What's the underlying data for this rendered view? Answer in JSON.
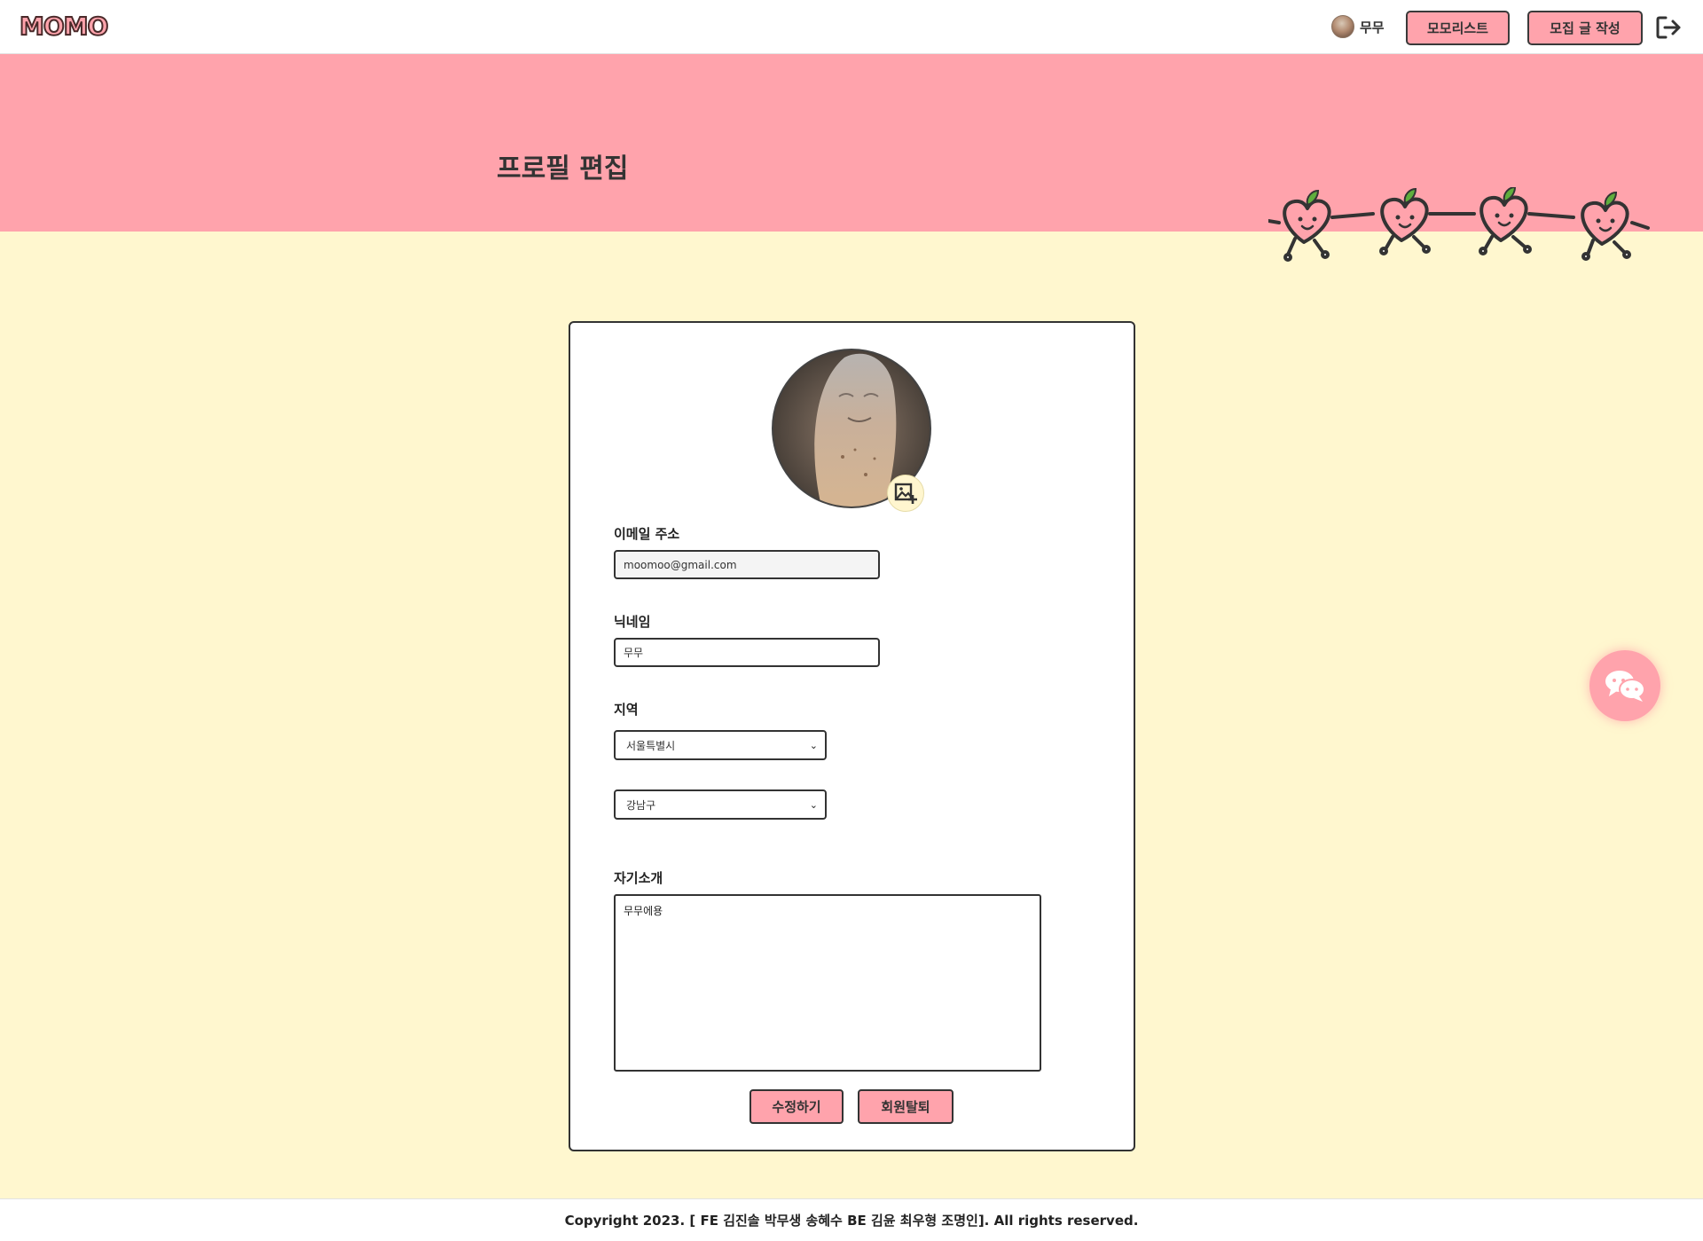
{
  "header": {
    "logo": "MOMO",
    "user": {
      "name": "무무"
    },
    "buttons": {
      "moment_list": "모모리스트",
      "write_post": "모집 글 작성"
    },
    "icons": {
      "logout": "logout-icon"
    }
  },
  "banner": {
    "title": "프로필 편집"
  },
  "form": {
    "email_label": "이메일 주소",
    "email_value": "moomoo@gmail.com",
    "nickname_label": "닉네임",
    "nickname_value": "무무",
    "region_label": "지역",
    "city_selected": "서울특별시",
    "district_selected": "강남구",
    "intro_label": "자기소개",
    "intro_value": "무무에용",
    "edit_button": "수정하기",
    "withdraw_button": "회원탈퇴"
  },
  "footer": {
    "copyright": "Copyright 2023. [ FE 김진솔 박무생 송혜수 BE 김윤 최우형 조명인]. All rights reserved."
  },
  "colors": {
    "pink": "#ffa3ac",
    "cream": "#fff7cf",
    "dark": "#333333"
  }
}
